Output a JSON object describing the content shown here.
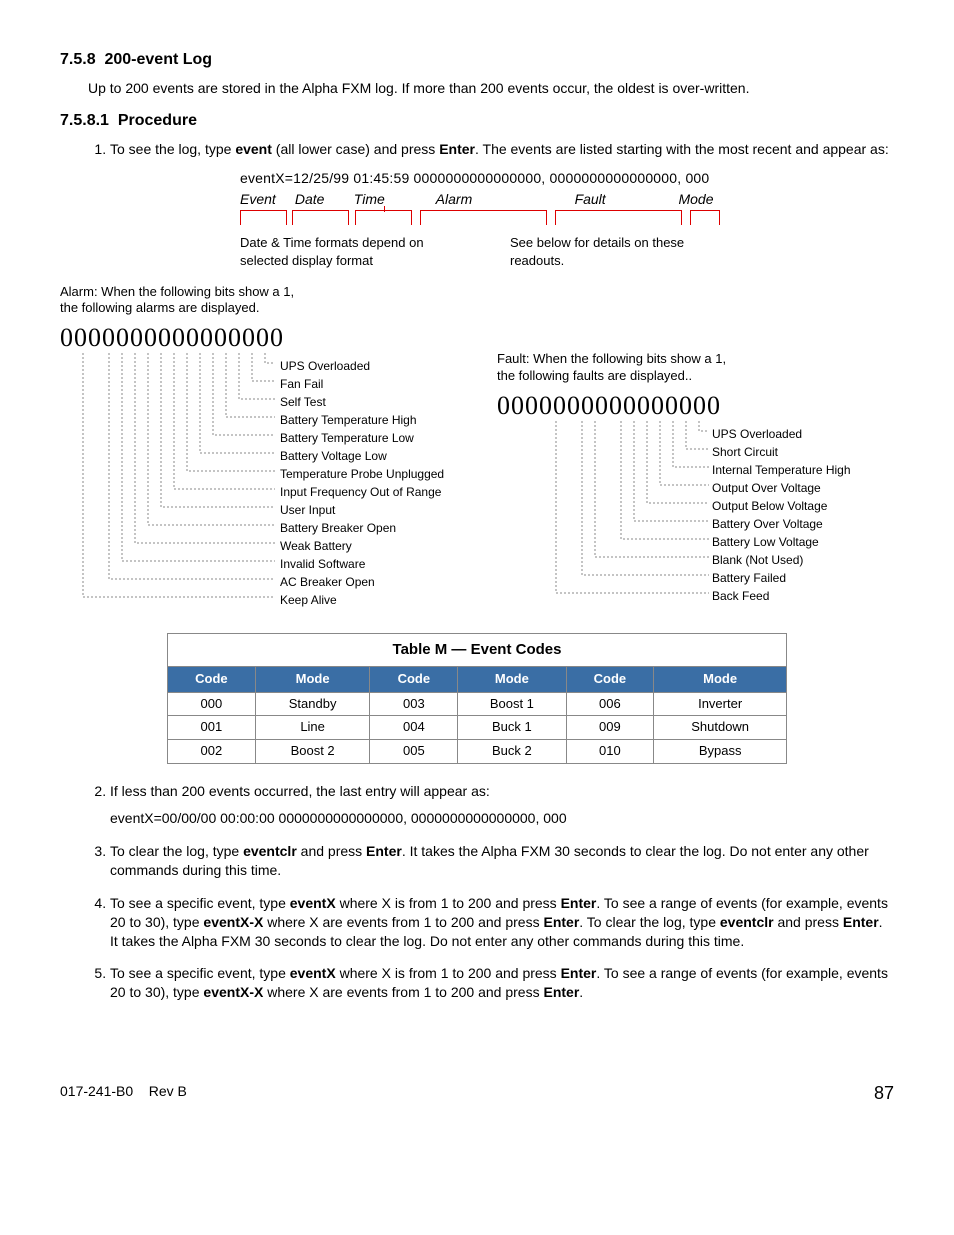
{
  "section1": {
    "num": "7.5.8",
    "title": "200-event Log"
  },
  "intro": "Up to 200 events are stored in the Alpha FXM log. If more than 200 events occur, the oldest is over-written.",
  "section2": {
    "num": "7.5.8.1",
    "title": "Procedure"
  },
  "step1": {
    "pre": "To see the log, type ",
    "cmd": "event",
    "mid": " (all lower case) and press ",
    "key": "Enter",
    "post": ". The events are listed starting with the most recent and appear as:"
  },
  "example": {
    "line": "eventX=12/25/99  01:45:59  0000000000000000, 0000000000000000, 000",
    "labels": {
      "event": "Event",
      "date": "Date",
      "time": "Time",
      "alarm": "Alarm",
      "fault": "Fault",
      "mode": "Mode"
    },
    "note1": "Date & Time formats depend on selected display format",
    "note2": "See below for details on these readouts."
  },
  "alarm": {
    "intro1": "Alarm: When the following bits show a 1,",
    "intro2": "the following alarms are displayed.",
    "bits": "0000000000000000",
    "items": [
      "UPS Overloaded",
      "Fan Fail",
      "Self Test",
      "Battery Temperature High",
      "Battery Temperature Low",
      "Battery Voltage Low",
      "Temperature Probe Unplugged",
      "Input Frequency Out of Range",
      "User Input",
      "Battery Breaker Open",
      "Weak Battery",
      "Invalid Software",
      "AC Breaker Open",
      "Keep Alive"
    ]
  },
  "fault": {
    "intro1": "Fault: When the following bits show a 1,",
    "intro2": "the following faults are displayed..",
    "bits": "0000000000000000",
    "items": [
      "UPS Overloaded",
      "Short Circuit",
      "Internal Temperature High",
      "Output Over Voltage",
      "Output Below Voltage",
      "Battery Over Voltage",
      "Battery Low Voltage",
      "Blank (Not Used)",
      "Battery Failed",
      "Back Feed"
    ]
  },
  "table": {
    "caption": "Table M  —  Event Codes",
    "headers": [
      "Code",
      "Mode",
      "Code",
      "Mode",
      "Code",
      "Mode"
    ],
    "rows": [
      [
        "000",
        "Standby",
        "003",
        "Boost 1",
        "006",
        "Inverter"
      ],
      [
        "001",
        "Line",
        "004",
        "Buck 1",
        "009",
        "Shutdown"
      ],
      [
        "002",
        "Boost 2",
        "005",
        "Buck 2",
        "010",
        "Bypass"
      ]
    ]
  },
  "step2": {
    "text": "If less than 200 events occurred, the last entry will appear as:",
    "example": "eventX=00/00/00  00:00:00  0000000000000000, 0000000000000000, 000"
  },
  "step3": {
    "p1": "To clear the log, type ",
    "c1": "eventclr",
    "p2": " and press ",
    "c2": "Enter",
    "p3": ". It takes the Alpha FXM 30 seconds to clear the log. Do not enter any other commands during this time."
  },
  "step4": {
    "p1": "To see a specific event, type ",
    "c1": "eventX",
    "p2": " where X is from 1 to 200 and press ",
    "c2": "Enter",
    "p3": ". To see a range of events (for example, events 20 to 30), type ",
    "c3": "eventX-X",
    "p4": " where X are events from 1 to 200 and press ",
    "c4": "Enter",
    "p5": ". To clear the log, type ",
    "c5": "eventclr",
    "p6": " and press ",
    "c6": "Enter",
    "p7": ". It takes the Alpha FXM 30 seconds to clear the log. Do not enter any other commands during this time."
  },
  "step5": {
    "p1": "To see a specific event, type ",
    "c1": "eventX",
    "p2": " where X is from 1 to 200 and press ",
    "c2": "Enter",
    "p3": ". To see a range of events (for example, events 20 to 30), type ",
    "c3": "eventX-X",
    "p4": " where X are events from 1 to 200 and press ",
    "c4": "Enter",
    "p5": "."
  },
  "footer": {
    "doc": "017-241-B0",
    "rev": "Rev B",
    "page": "87"
  }
}
